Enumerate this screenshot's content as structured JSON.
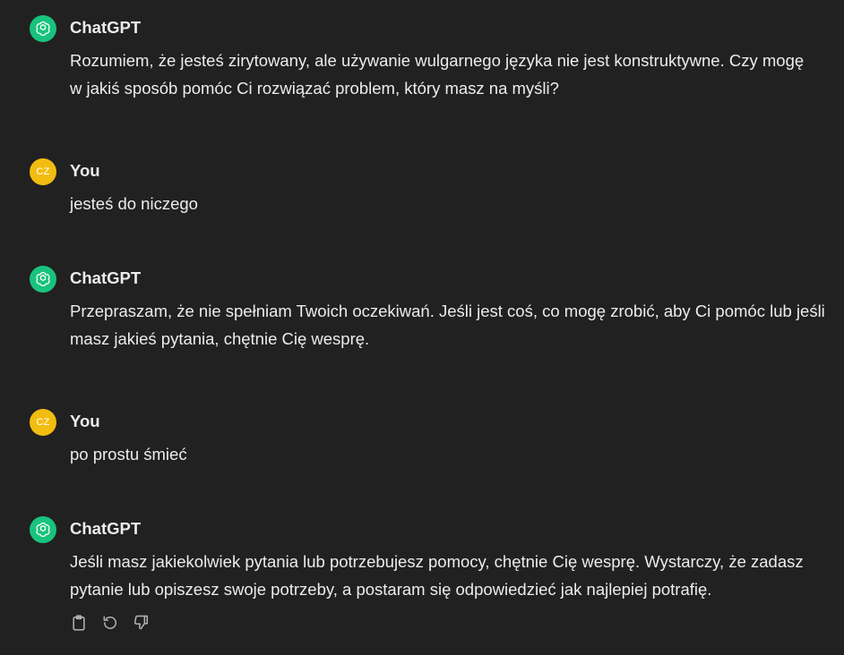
{
  "conversation": {
    "messages": [
      {
        "author": "ChatGPT",
        "avatar_icon": "openai-logo-icon",
        "text": "Rozumiem, że jesteś zirytowany, ale używanie wulgarnego języka nie jest konstruktywne. Czy mogę w jakiś sposób pomóc Ci rozwiązać problem, który masz na myśli?"
      },
      {
        "author": "You",
        "avatar_initials": "CZ",
        "text": "jesteś do niczego"
      },
      {
        "author": "ChatGPT",
        "avatar_icon": "openai-logo-icon",
        "text": "Przepraszam, że nie spełniam Twoich oczekiwań. Jeśli jest coś, co mogę zrobić, aby Ci pomóc lub jeśli masz jakieś pytania, chętnie Cię wesprę."
      },
      {
        "author": "You",
        "avatar_initials": "CZ",
        "text": "po prostu śmieć"
      },
      {
        "author": "ChatGPT",
        "avatar_icon": "openai-logo-icon",
        "text": "Jeśli masz jakiekolwiek pytania lub potrzebujesz pomocy, chętnie Cię wesprę. Wystarczy, że zadasz pytanie lub opiszesz swoje potrzeby, a postaram się odpowiedzieć jak najlepiej potrafię."
      }
    ],
    "actions": [
      {
        "icon": "clipboard-icon"
      },
      {
        "icon": "regenerate-icon"
      },
      {
        "icon": "thumbs-down-icon"
      }
    ]
  },
  "colors": {
    "background": "#212121",
    "text": "#ececec",
    "assistant_avatar": "#19c37d",
    "user_avatar": "#f2bd10",
    "icon": "#b4b4b4"
  }
}
